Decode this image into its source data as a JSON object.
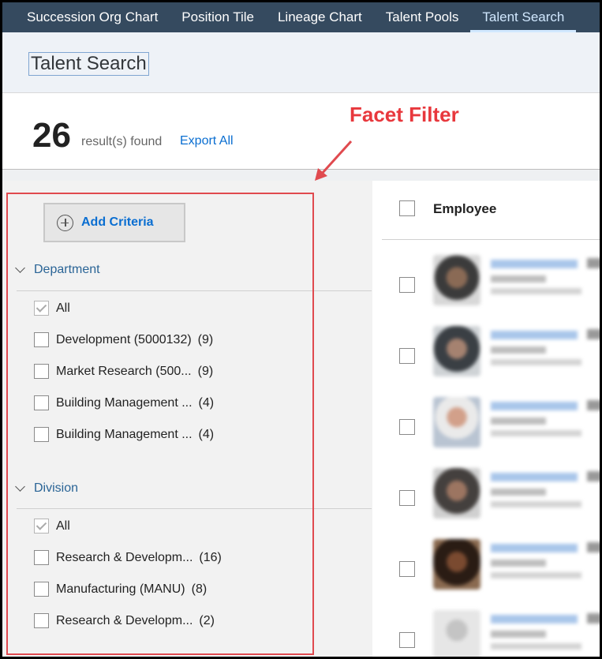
{
  "nav": {
    "tabs": [
      {
        "label": "Succession Org Chart",
        "active": false
      },
      {
        "label": "Position Tile",
        "active": false
      },
      {
        "label": "Lineage Chart",
        "active": false
      },
      {
        "label": "Talent Pools",
        "active": false
      },
      {
        "label": "Talent Search",
        "active": true
      }
    ]
  },
  "page": {
    "title": "Talent Search"
  },
  "results": {
    "count": "26",
    "label": "result(s) found",
    "export_label": "Export All"
  },
  "annotation": {
    "text": "Facet Filter",
    "color": "#e8383d"
  },
  "filters": {
    "add_criteria_label": "Add Criteria",
    "groups": [
      {
        "title": "Department",
        "options": [
          {
            "label": "All",
            "count": "",
            "checked": true
          },
          {
            "label": "Development (5000132)",
            "count": "(9)",
            "checked": false
          },
          {
            "label": "Market Research (500...",
            "count": "(9)",
            "checked": false
          },
          {
            "label": "Building Management ...",
            "count": "(4)",
            "checked": false
          },
          {
            "label": "Building Management ...",
            "count": "(4)",
            "checked": false
          }
        ]
      },
      {
        "title": "Division",
        "options": [
          {
            "label": "All",
            "count": "",
            "checked": true
          },
          {
            "label": "Research & Developm...",
            "count": "(16)",
            "checked": false
          },
          {
            "label": "Manufacturing (MANU)",
            "count": "(8)",
            "checked": false
          },
          {
            "label": "Research & Developm...",
            "count": "(2)",
            "checked": false
          }
        ]
      }
    ]
  },
  "employees": {
    "column_label": "Employee"
  },
  "colors": {
    "nav_bg": "#354a5f",
    "link": "#0a6ed1",
    "facet_border": "#e04a4f"
  }
}
